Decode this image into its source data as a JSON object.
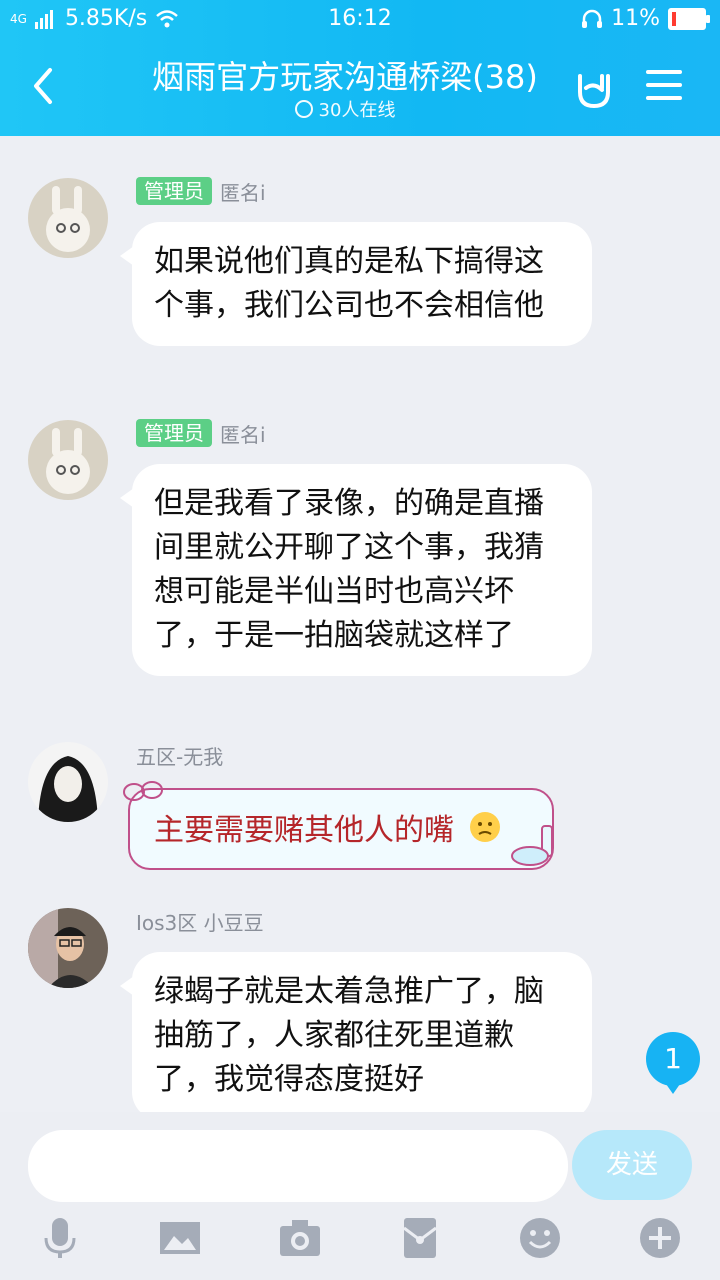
{
  "status": {
    "network": "4G",
    "speed": "5.85K/s",
    "time": "16:12",
    "battery": "11%",
    "battery_level": 0.11
  },
  "header": {
    "title": "烟雨官方玩家沟通桥梁(38)",
    "online": "30人在线"
  },
  "messages": [
    {
      "role": "管理员",
      "name": "匿名i",
      "text": "如果说他们真的是私下搞得这个事，我们公司也不会相信他"
    },
    {
      "role": "管理员",
      "name": "匿名i",
      "text": "但是我看了录像，的确是直播间里就公开聊了这个事，我猜想可能是半仙当时也高兴坏了，于是一拍脑袋就这样了"
    },
    {
      "name": "五区-无我",
      "text": "主要需要赌其他人的嘴"
    },
    {
      "name": "Ios3区 小豆豆",
      "text": "绿蝎子就是太着急推广了，脑抽筋了，人家都往死里道歉了，我觉得态度挺好"
    }
  ],
  "unread_badge": "1",
  "input": {
    "value": "",
    "send_label": "发送"
  },
  "toolbar": [
    "mic-icon",
    "image-icon",
    "camera-icon",
    "redpacket-icon",
    "emoji-icon",
    "plus-icon"
  ],
  "colors": {
    "accent": "#12b8f3",
    "admin_tag": "#5ccf86",
    "fancy_text": "#b5262a"
  }
}
